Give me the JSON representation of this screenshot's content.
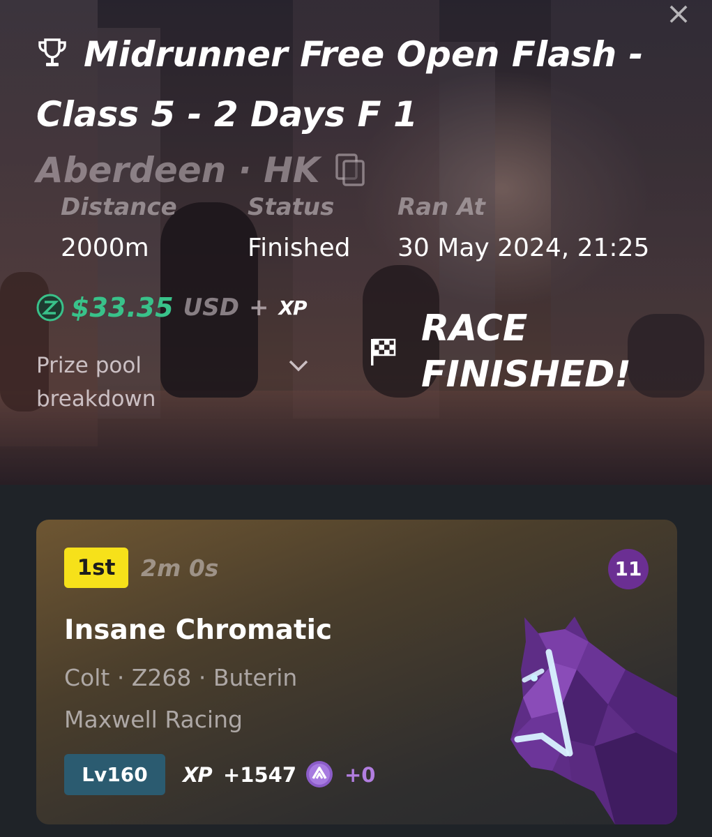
{
  "race": {
    "title": "Midrunner Free Open Flash - Class 5 - 2 Days F 1",
    "location": "Aberdeen · HK",
    "stats": [
      {
        "label": "Distance",
        "value": "2000m"
      },
      {
        "label": "Status",
        "value": "Finished"
      },
      {
        "label": "Ran At",
        "value": "30 May 2024, 21:25"
      }
    ],
    "prize": {
      "amount": "$33.35",
      "currency": "USD",
      "plus": "+",
      "xp": "XP",
      "breakdown_label": "Prize pool breakdown"
    },
    "finished_text": "RACE FINISHED!"
  },
  "result": {
    "position": "1st",
    "time": "2m 0s",
    "gate": "11",
    "horse_name": "Insane Chromatic",
    "meta": "Colt · Z268 · Buterin",
    "stable": "Maxwell Racing",
    "level": "Lv160",
    "xp_label": "XP",
    "xp_gain": "+1547",
    "token_gain": "+0"
  },
  "icons": {
    "close": "close-icon",
    "trophy": "trophy-icon",
    "copy": "copy-icon",
    "coin": "zed-coin-icon",
    "chevron": "chevron-down-icon",
    "flag": "checkered-flag-icon",
    "token": "token-icon",
    "horse": "horse-head-illustration"
  },
  "colors": {
    "prize_green": "#39c28a",
    "rank_yellow": "#f6e11a",
    "gate_purple": "#6b2f93",
    "level_teal": "#2b5b70",
    "token_purple": "#b27ee0",
    "page_bg": "#1f2328"
  }
}
